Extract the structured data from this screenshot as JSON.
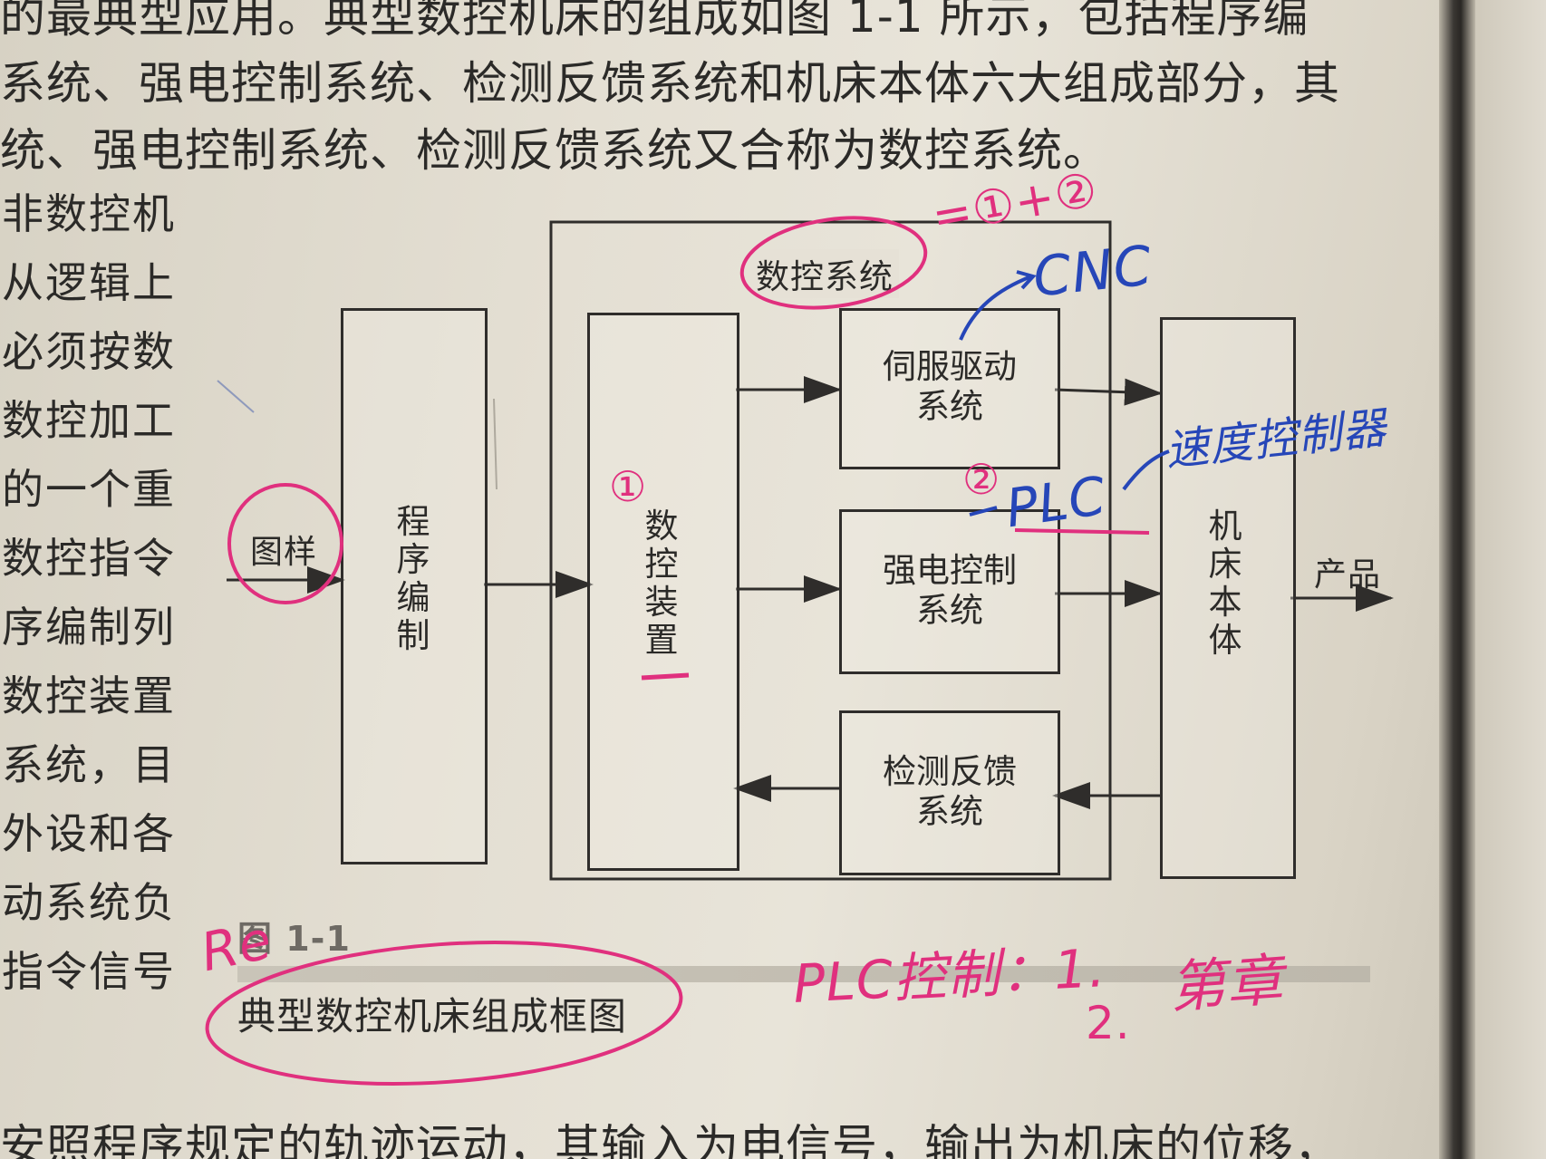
{
  "body_text": {
    "line1": "的最典型应用。典型数控机床的组成如图 1-1 所示，包括程序编",
    "line2": "系统、强电控制系统、检测反馈系统和机床本体六大组成部分，其",
    "line3": "统、强电控制系统、检测反馈系统又合称为数控系统。",
    "bottom_line": "安照程序规定的轨迹运动，其输入为电信号，输出为机床的位移，"
  },
  "left_column": [
    "非数控机",
    "从逻辑上",
    "必须按数",
    "数控加工",
    "的一个重",
    "数控指令",
    "序编制列",
    "数控装置",
    "系统，目",
    "外设和各",
    "动系统负",
    "指令信号"
  ],
  "diagram": {
    "input_label": "图样",
    "program_box": "程序编制",
    "nc_system_label": "数控系统",
    "nc_device": "数控装置",
    "servo_box": "伺服驱动\n系统",
    "power_box": "强电控制\n系统",
    "feedback_box": "检测反馈\n系统",
    "machine_box": "机床本体",
    "output_label": "产品"
  },
  "caption": {
    "number": "图 1-1",
    "title": "典型数控机床组成框图"
  },
  "annotations": {
    "pink_formula": "=①+②",
    "pink_one": "①",
    "pink_two": "②",
    "pink_plc_note": "PLC控制：1.",
    "pink_plc_note2": "2.",
    "pink_chapter": "第章",
    "blue_cnc": "CNC",
    "blue_plc": "PLC",
    "blue_speed": "速度控制器",
    "margin_re": "Re"
  },
  "colors": {
    "ink": "#2b2a28",
    "pink_pen": "#e0307e",
    "blue_pen": "#2646b8"
  }
}
